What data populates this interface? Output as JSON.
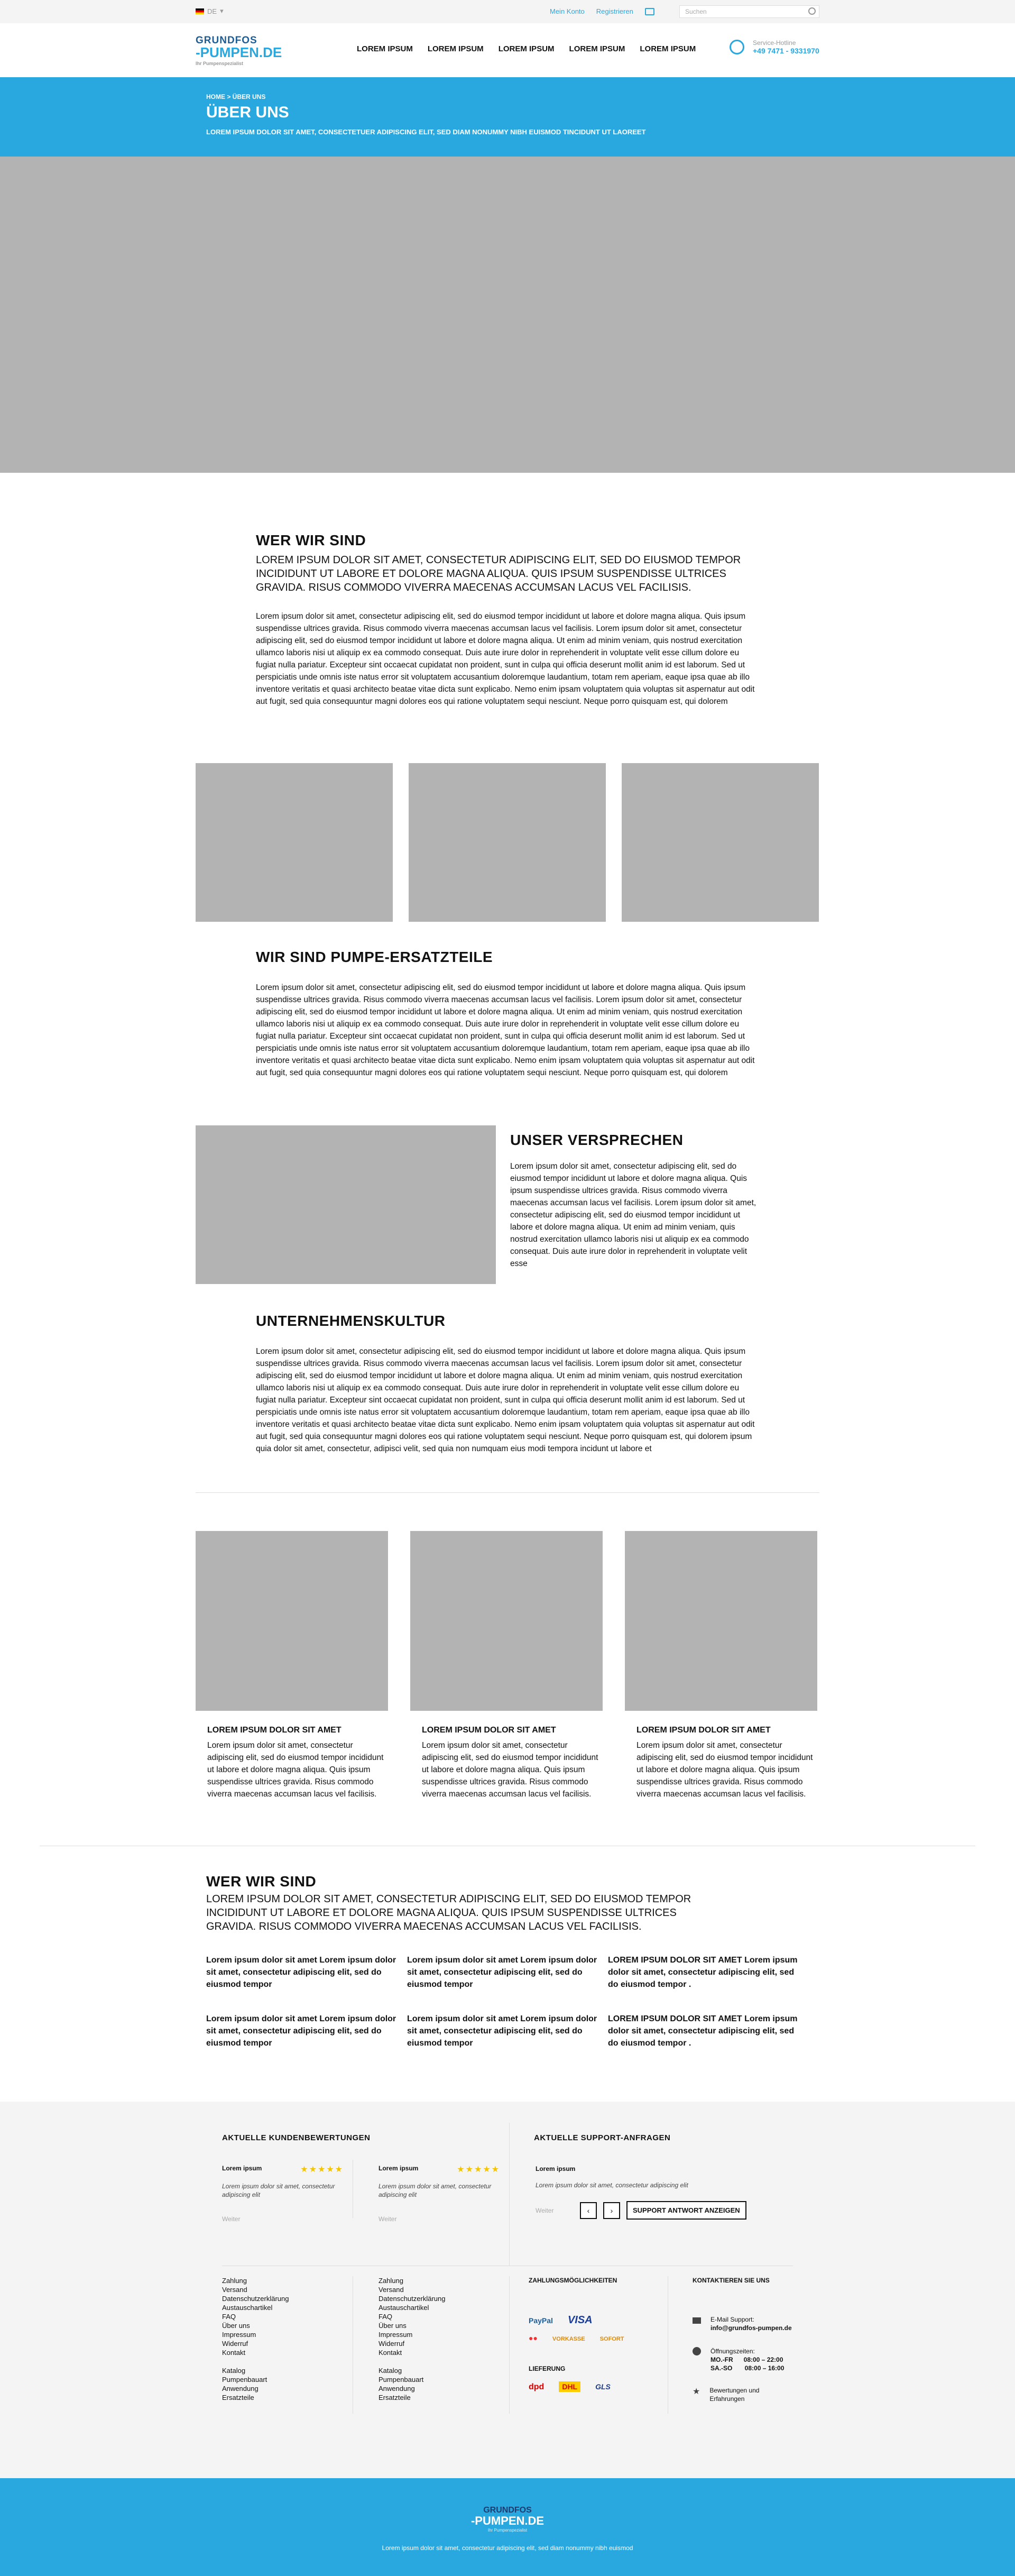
{
  "topbar": {
    "lang": "DE",
    "my_account": "Mein Konto",
    "register": "Registrieren",
    "search_placeholder": "Suchen"
  },
  "header": {
    "logo_line1": "GRUNDFOS",
    "logo_line2": "-PUMPEN.DE",
    "logo_tag": "Ihr Pumpenspezialist",
    "nav": [
      "LOREM IPSUM",
      "LOREM IPSUM",
      "LOREM IPSUM",
      "LOREM IPSUM",
      "LOREM IPSUM"
    ],
    "service_label": "Service-Hotline",
    "service_phone": "+49 7471 - 9331970"
  },
  "hero": {
    "breadcrumb": "HOME > ÜBER UNS",
    "title": "ÜBER UNS",
    "subtitle": "LOREM IPSUM DOLOR SIT AMET, CONSECTETUER ADIPISCING ELIT, SED DIAM NONUMMY NIBH EUISMOD TINCIDUNT UT LAOREET"
  },
  "s1": {
    "title": "WER WIR SIND",
    "lead": "LOREM IPSUM DOLOR SIT AMET, CONSECTETUR ADIPISCING ELIT, SED DO EIUSMOD TEMPOR INCIDIDUNT UT LABORE ET DOLORE MAGNA ALIQUA. QUIS IPSUM SUSPENDISSE ULTRICES GRAVIDA. RISUS COMMODO VIVERRA MAECENAS ACCUMSAN LACUS VEL FACILISIS.",
    "body": "Lorem ipsum dolor sit amet, consectetur adipiscing elit, sed do eiusmod tempor incididunt ut labore et dolore magna aliqua. Quis ipsum suspendisse ultrices gravida. Risus commodo viverra maecenas accumsan lacus vel facilisis. Lorem ipsum dolor sit amet, consectetur adipiscing elit, sed do eiusmod tempor incididunt ut labore et dolore magna aliqua. Ut enim ad minim veniam, quis nostrud exercitation ullamco laboris nisi ut aliquip ex ea commodo consequat. Duis aute irure dolor in reprehenderit in voluptate velit esse cillum dolore eu fugiat nulla pariatur. Excepteur sint occaecat cupidatat non proident, sunt in culpa qui officia deserunt mollit anim id est laborum. Sed ut perspiciatis unde omnis iste natus error sit voluptatem accusantium doloremque laudantium, totam rem aperiam, eaque ipsa quae ab illo inventore veritatis et quasi architecto beatae vitae dicta sunt explicabo. Nemo enim ipsam voluptatem quia voluptas sit aspernatur aut odit aut fugit, sed quia consequuntur magni dolores eos qui ratione voluptatem sequi nesciunt. Neque porro quisquam est, qui dolorem"
  },
  "s2": {
    "title": "WIR SIND PUMPE-ERSATZTEILE",
    "body": "Lorem ipsum dolor sit amet, consectetur adipiscing elit, sed do eiusmod tempor incididunt ut labore et dolore magna aliqua. Quis ipsum suspendisse ultrices gravida. Risus commodo viverra maecenas accumsan lacus vel facilisis. Lorem ipsum dolor sit amet, consectetur adipiscing elit, sed do eiusmod tempor incididunt ut labore et dolore magna aliqua. Ut enim ad minim veniam, quis nostrud exercitation ullamco laboris nisi ut aliquip ex ea commodo consequat. Duis aute irure dolor in reprehenderit in voluptate velit esse cillum dolore eu fugiat nulla pariatur. Excepteur sint occaecat cupidatat non proident, sunt in culpa qui officia deserunt mollit anim id est laborum. Sed ut perspiciatis unde omnis iste natus error sit voluptatem accusantium doloremque laudantium, totam rem aperiam, eaque ipsa quae ab illo inventore veritatis et quasi architecto beatae vitae dicta sunt explicabo. Nemo enim ipsam voluptatem quia voluptas sit aspernatur aut odit aut fugit, sed quia consequuntur magni dolores eos qui ratione voluptatem sequi nesciunt. Neque porro quisquam est, qui dolorem"
  },
  "s3": {
    "title": "UNSER VERSPRECHEN",
    "body": "Lorem ipsum dolor sit amet, consectetur adipiscing elit, sed do eiusmod tempor incididunt ut labore et dolore magna aliqua. Quis ipsum suspendisse ultrices gravida. Risus commodo viverra maecenas accumsan lacus vel facilisis. Lorem ipsum dolor sit amet, consectetur adipiscing elit, sed do eiusmod tempor incididunt ut labore et dolore magna aliqua. Ut enim ad minim veniam, quis nostrud exercitation ullamco laboris nisi ut aliquip ex ea commodo consequat. Duis aute irure dolor in reprehenderit in voluptate velit esse"
  },
  "s4": {
    "title": "UNTERNEHMENSKULTUR",
    "body": "Lorem ipsum dolor sit amet, consectetur adipiscing elit, sed do eiusmod tempor incididunt ut labore et dolore magna aliqua. Quis ipsum suspendisse ultrices gravida. Risus commodo viverra maecenas accumsan lacus vel facilisis. Lorem ipsum dolor sit amet, consectetur adipiscing elit, sed do eiusmod tempor incididunt ut labore et dolore magna aliqua. Ut enim ad minim veniam, quis nostrud exercitation ullamco laboris nisi ut aliquip ex ea commodo consequat. Duis aute irure dolor in reprehenderit in voluptate velit esse cillum dolore eu fugiat nulla pariatur. Excepteur sint occaecat cupidatat non proident, sunt in culpa qui officia deserunt mollit anim id est laborum. Sed ut perspiciatis unde omnis iste natus error sit voluptatem accusantium doloremque laudantium, totam rem aperiam, eaque ipsa quae ab illo inventore veritatis et quasi architecto beatae vitae dicta sunt explicabo. Nemo enim ipsam voluptatem quia voluptas sit aspernatur aut odit aut fugit, sed quia consequuntur magni dolores eos qui ratione voluptatem sequi nesciunt. Neque porro quisquam est, qui dolorem ipsum quia dolor sit amet, consectetur, adipisci velit, sed quia non numquam eius modi tempora incidunt ut labore et"
  },
  "cards": [
    {
      "title": "LOREM IPSUM DOLOR SIT AMET",
      "text": "Lorem ipsum dolor sit amet, consectetur adipiscing elit, sed do eiusmod tempor incididunt ut labore et dolore magna aliqua. Quis ipsum suspendisse ultrices gravida. Risus commodo viverra maecenas accumsan lacus vel facilisis."
    },
    {
      "title": "LOREM IPSUM DOLOR SIT AMET",
      "text": "Lorem ipsum dolor sit amet, consectetur adipiscing elit, sed do eiusmod tempor incididunt ut labore et dolore magna aliqua. Quis ipsum suspendisse ultrices gravida. Risus commodo viverra maecenas accumsan lacus vel facilisis."
    },
    {
      "title": "LOREM IPSUM DOLOR SIT AMET",
      "text": "Lorem ipsum dolor sit amet, consectetur adipiscing elit, sed do eiusmod tempor incididunt ut labore et dolore magna aliqua. Quis ipsum suspendisse ultrices gravida. Risus commodo viverra maecenas accumsan lacus vel facilisis."
    }
  ],
  "s5": {
    "title": "WER WIR SIND",
    "lead": "LOREM IPSUM DOLOR SIT AMET, CONSECTETUR ADIPISCING ELIT, SED DO EIUSMOD TEMPOR INCIDIDUNT UT LABORE ET DOLORE MAGNA ALIQUA. QUIS IPSUM SUSPENDISSE ULTRICES GRAVIDA. RISUS COMMODO VIVERRA MAECENAS ACCUMSAN LACUS VEL FACILISIS.",
    "items": [
      "Lorem ipsum dolor sit amet Lorem ipsum dolor sit amet, consectetur adipiscing elit, sed do eiusmod tempor",
      "Lorem ipsum dolor sit amet Lorem ipsum dolor sit amet, consectetur adipiscing elit, sed do eiusmod tempor",
      "LOREM IPSUM DOLOR SIT AMET Lorem ipsum dolor sit amet, consectetur adipiscing elit, sed do eiusmod tempor .",
      "Lorem ipsum dolor sit amet Lorem ipsum dolor sit amet, consectetur adipiscing elit, sed do eiusmod tempor",
      "Lorem ipsum dolor sit amet Lorem ipsum dolor sit amet, consectetur adipiscing elit, sed do eiusmod tempor",
      "LOREM IPSUM DOLOR SIT AMET Lorem ipsum dolor sit amet, consectetur adipiscing elit, sed do eiusmod tempor ."
    ]
  },
  "footer": {
    "reviews_title": "AKTUELLE KUNDENBEWERTUNGEN",
    "support_title": "AKTUELLE SUPPORT-ANFRAGEN",
    "reviews": [
      {
        "name": "Lorem ipsum",
        "stars": "★★★★★",
        "text": "Lorem ipsum dolor sit amet, consectetur adipiscing elit",
        "more": "Weiter"
      },
      {
        "name": "Lorem ipsum",
        "stars": "★★★★★",
        "text": "Lorem ipsum dolor sit amet, consectetur adipiscing elit",
        "more": "Weiter"
      }
    ],
    "support": {
      "name": "Lorem ipsum",
      "text": "Lorem ipsum dolor sit amet, consectetur adipiscing elit",
      "more": "Weiter",
      "prev": "‹",
      "next": "›",
      "button": "SUPPORT ANTWORT ANZEIGEN"
    },
    "links1": [
      "Zahlung",
      "Versand",
      "Datenschutzerklärung",
      "Austauschartikel",
      "FAQ",
      "Über uns",
      "Impressum",
      "Widerruf",
      "Kontakt",
      "",
      "Katalog",
      "Pumpenbauart",
      "Anwendung",
      "Ersatzteile"
    ],
    "links2": [
      "Zahlung",
      "Versand",
      "Datenschutzerklärung",
      "Austauschartikel",
      "FAQ",
      "Über uns",
      "Impressum",
      "Widerruf",
      "Kontakt",
      "",
      "Katalog",
      "Pumpenbauart",
      "Anwendung",
      "Ersatzteile"
    ],
    "payment_title": "ZAHLUNGSMÖGLICHKEITEN",
    "payments": [
      "PayPal",
      "VISA",
      "●●",
      "VORKASSE",
      "SOFORT"
    ],
    "delivery_title": "LIEFERUNG",
    "carriers": [
      "dpd",
      "DHL",
      "GLS"
    ],
    "contact_title": "KONTAKTIEREN SIE UNS",
    "email_label": "E-Mail Support:",
    "email": "info@grundfos-pumpen.de",
    "hours_label": "Öffnungszeiten:",
    "hours1": "MO.-FR      08:00 – 22:00",
    "hours2": "SA.-SO       08:00 – 16:00",
    "reviews_link1": "Bewertungen und",
    "reviews_link2": "Erfahrungen",
    "bottom_logo1": "GRUNDFOS",
    "bottom_logo2": "-PUMPEN.DE",
    "bottom_tag": "Ihr Pumpenspezialist",
    "bottom_text": "Lorem ipsum dolor sit amet, consectetur adipiscing elit, sed diam nonummy nibh euismod"
  }
}
